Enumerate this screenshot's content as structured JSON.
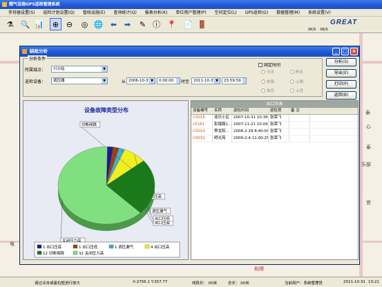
{
  "app": {
    "title": "燃气设施GPS巡检管理系统"
  },
  "menu": [
    "手持器设置(S)",
    "巡检计划设置(Q)",
    "管线设施(E)",
    "查询统计(Q)",
    "报表分析(K)",
    "单位用户管理(P)",
    "空间定位(L)",
    "GPS巡检(G)",
    "数据管理(M)",
    "系统设置(V)"
  ],
  "toolbar": {
    "logo": "GREAT",
    "status1": "0K/S",
    "status2": "0K/S"
  },
  "map": {
    "labels": [
      "泰",
      "心",
      "泰",
      "乐部",
      "宫",
      "电",
      "和得"
    ]
  },
  "dialog": {
    "title": "缺陷分析",
    "group_title": "分析条件",
    "area_label": "所属城点：",
    "area_value": "川沙站",
    "device_label": "巡检设备：",
    "device_value": "调压器",
    "from_label": "从",
    "from_date": "2006-10-31",
    "from_time": "0:00:00",
    "to_label": "时至",
    "to_date": "2011-10-31",
    "to_time": "23:59:59",
    "fixed_time_label": "固定时间",
    "radios": [
      "今天",
      "昨天",
      "本周",
      "上周",
      "本月",
      "上月"
    ],
    "buttons": {
      "analyze": "分析(S)",
      "export": "导出(E)",
      "print": "打印(P)",
      "back": "返回(B)"
    }
  },
  "chart_data": {
    "type": "pie",
    "title": "设备故障类型分布",
    "categories": [
      "出口压底",
      "出口压低",
      "调压漏气",
      "出口压高",
      "切断阀跳",
      "关闭压力高"
    ],
    "values": [
      1,
      1,
      1,
      4,
      12,
      32
    ],
    "colors": [
      "#1a1a9a",
      "#a04010",
      "#40b0d0",
      "#f0f020",
      "#1a7a1a",
      "#80e080"
    ],
    "slice_labels": [
      "出口压底",
      "出口压低",
      "调压漏气",
      "出口压高",
      "切断阀跳",
      "关闭压力高"
    ],
    "legend": [
      "1 出口压底",
      "1 出口压低",
      "1 调压漏气",
      "4 出口压高",
      "12 切断阀跳",
      "32 关闭压力高"
    ]
  },
  "grid": {
    "header": "出口压高",
    "columns": [
      "设备编号",
      "名称",
      "巡检时间",
      "巡检员",
      "备 注"
    ],
    "rows": [
      [
        "C0016",
        "连乐小区",
        "2007-10-31 10:39...",
        "张荣飞",
        ""
      ],
      [
        "c0181",
        "彭镇路1...",
        "2007-11-21 10:09...",
        "张荣飞",
        ""
      ],
      [
        "C0010",
        "界龙阳...",
        "2008-2-29 8:40:04",
        "张荣飞",
        ""
      ],
      [
        "C0032",
        "明光苑",
        "2009-2-4 11:00:25",
        "张荣飞",
        ""
      ]
    ]
  },
  "statusbar": {
    "hint": "请过点击或者拉框进行放大",
    "coords": "X:2756.1 Y:357.77",
    "line_len": "线段长：.00米",
    "total_len": "总长：.00米",
    "user": "当前用户：系统管理员",
    "date": "2011-10-31",
    "time": "13:21"
  }
}
